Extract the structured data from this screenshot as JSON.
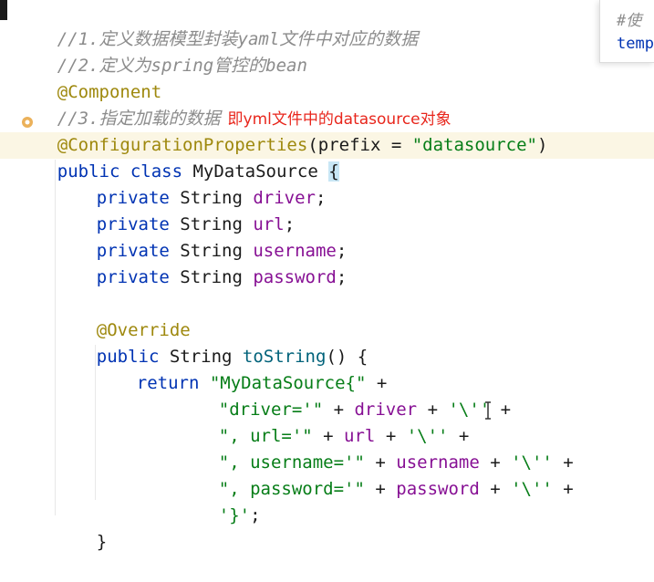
{
  "code": {
    "comment1": "//1.定义数据模型封装yaml文件中对应的数据",
    "comment2": "//2.定义为spring管控的bean",
    "annotation_component": "@Component",
    "comment3": "//3.指定加载的数据",
    "note": "即yml文件中的datasource对象",
    "config_props_annotation": "@ConfigurationProperties",
    "config_props_open": "(prefix = ",
    "config_props_value": "\"datasource\"",
    "config_props_close": ")",
    "class_kw": "public class ",
    "class_name": "MyDataSource ",
    "class_open_brace": "{",
    "private_kw": "private ",
    "string_type": "String ",
    "fields": [
      "driver",
      "url",
      "username",
      "password"
    ],
    "semicolon": ";",
    "override": "@Override",
    "public_kw": "public ",
    "method_name": "toString",
    "method_sig_rest": "() {",
    "return_kw": "return ",
    "ret_line1_str": "\"MyDataSource{\"",
    "plus": " +",
    "ret_lines": [
      {
        "str": "\"driver='\"",
        "field": "driver",
        "tail": "'\\''"
      },
      {
        "str": "\", url='\"",
        "field": "url",
        "tail": "'\\''"
      },
      {
        "str": "\", username='\"",
        "field": "username",
        "tail": "'\\''"
      },
      {
        "str": "\", password='\"",
        "field": "password",
        "tail": "'\\''"
      }
    ],
    "plus_mid": " + ",
    "last_str": "'}'",
    "close_brace": "}"
  },
  "peek_popup": {
    "line1": "#使",
    "line2": "temp"
  }
}
